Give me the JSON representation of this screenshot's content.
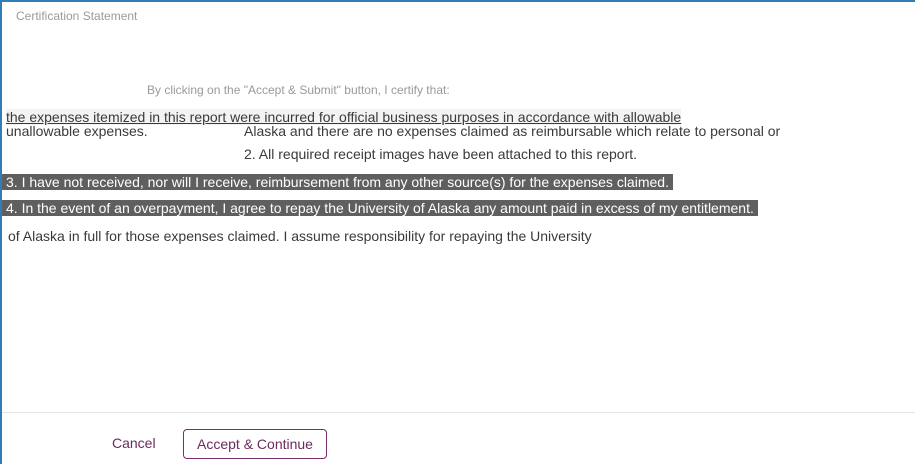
{
  "statement": {
    "title": "Certification Statement",
    "lines": [
      "By clicking on the \"Accept & Submit\" button, I certify that:",
      "the expenses itemized in this report were incurred for official business purposes in accordance with allowable",
      "unallowable expenses.",
      "Alaska and there are no expenses claimed as reimbursable which relate to personal or",
      "2. All required receipt images have been attached to this report.",
      "3. I have not received, nor will I receive, reimbursement from any other source(s) for the expenses claimed.",
      "4. In the event of an overpayment, I agree to repay the University of Alaska any amount paid in excess of my entitlement.",
      "of Alaska in full for those expenses claimed. I assume responsibility for repaying the University"
    ]
  },
  "footer": {
    "cancel_label": "Cancel",
    "accept_label": "Accept & Continue"
  }
}
